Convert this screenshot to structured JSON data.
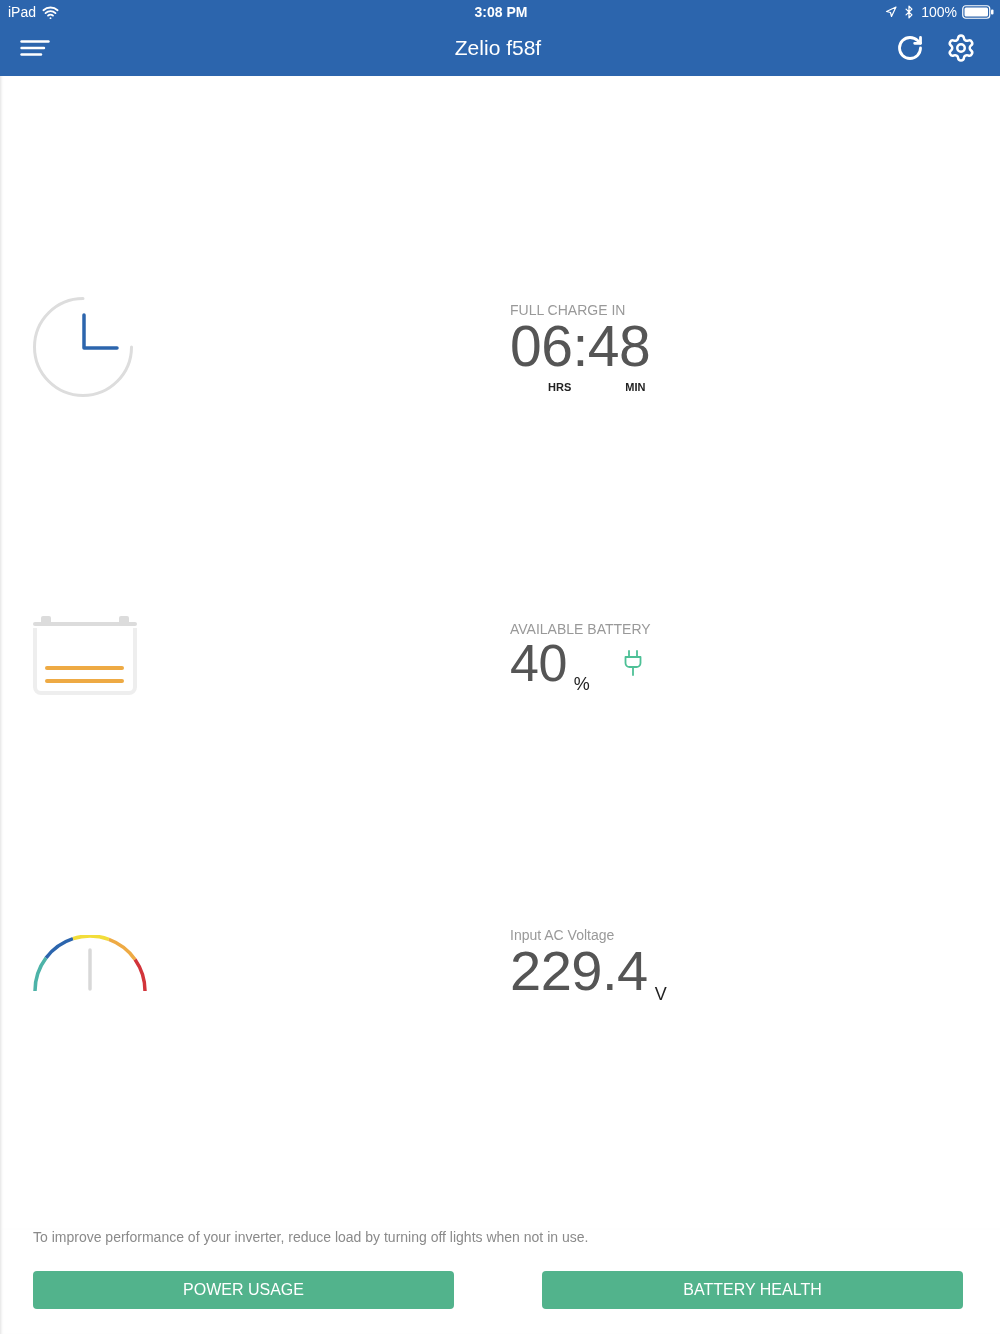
{
  "status_bar": {
    "device": "iPad",
    "time": "3:08 PM",
    "battery": "100%"
  },
  "nav_bar": {
    "title": "Zelio f58f"
  },
  "stats": [
    {
      "kind": "time",
      "label": "FULL CHARGE IN",
      "value": "06:48",
      "units": [
        "HRS",
        "MIN"
      ]
    },
    {
      "kind": "battery",
      "label": "AVAILABLE BATTERY",
      "value": "40",
      "unit": "%",
      "charging": true
    },
    {
      "kind": "voltage",
      "label": "Input AC Voltage",
      "value": "229.4",
      "unit": "V"
    }
  ],
  "tip": "To improve performance of your inverter, reduce load by turning off lights when not in use.",
  "buttons": [
    "POWER USAGE",
    "BATTERY HEALTH"
  ]
}
